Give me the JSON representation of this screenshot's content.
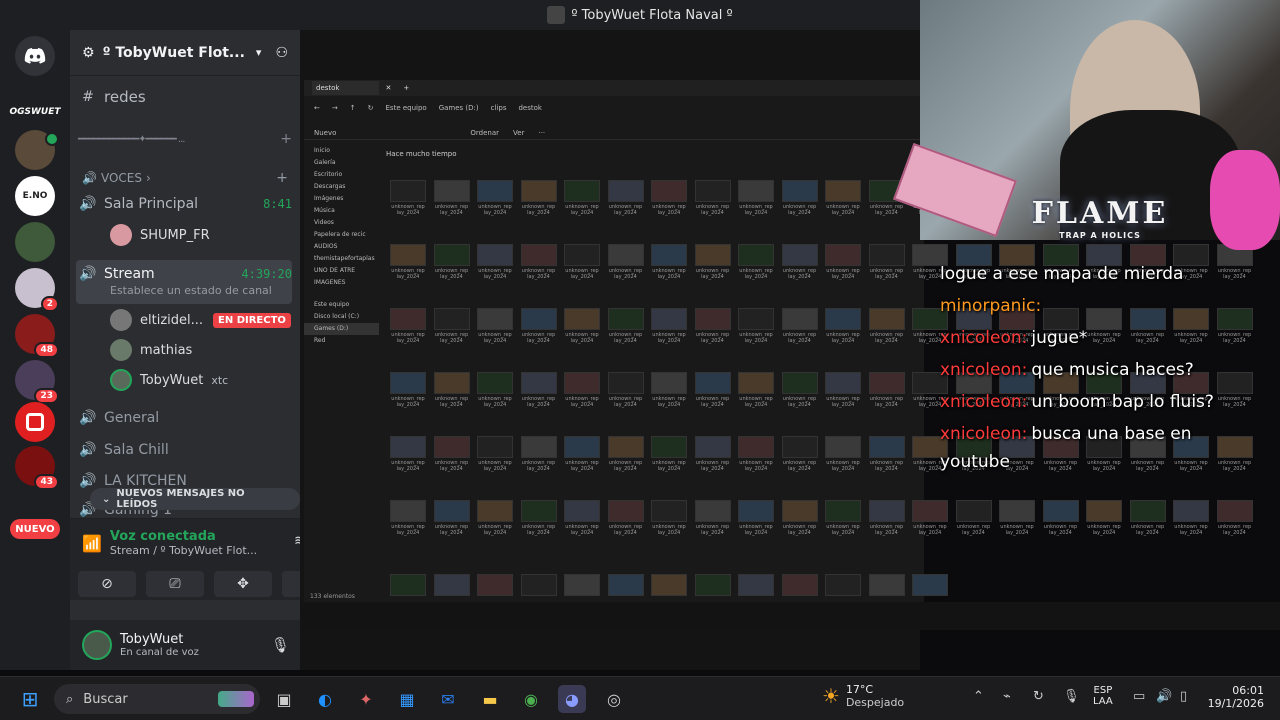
{
  "window": {
    "title": "º TobyWuet Flota Naval º"
  },
  "rail": {
    "servers": [
      {
        "name": "discord-home",
        "badge": ""
      },
      {
        "name": "server-ogswuet",
        "label": "OGSWUET",
        "badge": ""
      },
      {
        "name": "server-1",
        "badge": ""
      },
      {
        "name": "server-eno",
        "label": "E.NO",
        "badge": ""
      },
      {
        "name": "server-2",
        "badge": ""
      },
      {
        "name": "server-3",
        "badge": "2"
      },
      {
        "name": "server-4",
        "badge": "48"
      },
      {
        "name": "server-5",
        "badge": "23"
      },
      {
        "name": "server-6",
        "badge": ""
      },
      {
        "name": "server-7",
        "badge": "43"
      }
    ],
    "nuevo": "NUEVO"
  },
  "guild": {
    "name": "º TobyWuet Flot...",
    "channel_redes": "redes",
    "separator": "━━━━━━━━━━━━✦━━━━━━ ..."
  },
  "voice_category": "VOCES",
  "channels": {
    "sala_principal": {
      "name": "Sala Principal",
      "time": "8:41"
    },
    "shump": "SHUMP_FR",
    "stream": {
      "name": "Stream",
      "time": "4:39:20",
      "status": "Establece un estado de canal"
    },
    "users": [
      {
        "name": "eltizidel...",
        "live": "EN DIRECTO"
      },
      {
        "name": "mathias",
        "extra": ""
      },
      {
        "name": "TobyWuet",
        "extra": "xtc"
      }
    ],
    "general": "General",
    "sala_chill": "Sala Chill",
    "kitchen": "LA KITCHEN",
    "gaming": "Gaming 1",
    "new_messages": "NUEVOS MENSAJES NO LEÍDOS"
  },
  "voice_panel": {
    "status": "Voz conectada",
    "location": "Stream / º TobyWuet Flot..."
  },
  "user_panel": {
    "name": "TobyWuet",
    "status": "En canal de voz"
  },
  "explorer": {
    "tab": "destok",
    "path": [
      "Este equipo",
      "Games (D:)",
      "clips",
      "destok"
    ],
    "toolbar": [
      "Nuevo",
      "Ordenar",
      "Ver"
    ],
    "group": "Hace mucho tiempo",
    "nav": [
      "Inicio",
      "Galería",
      "Escritorio",
      "Descargas",
      "Imágenes",
      "Música",
      "Videos",
      "Papelera de recic",
      "AUDIOS",
      "themistapefortaplas",
      "UNO DE ATRE",
      "IMAGENES",
      "Este equipo",
      "Disco local (C:)",
      "Games (D:)",
      "Red"
    ],
    "count": "133 elementos",
    "file_label": "unknown_rep lay_2024"
  },
  "cam": {
    "title": "FLAME",
    "subtitle": "TRAP A HOLICS"
  },
  "chat": [
    {
      "user": "",
      "text": "logue a ese mapa de mierda",
      "color": "#ffffff"
    },
    {
      "user": "minorpanic:",
      "text": "",
      "color": "#ff9a1f"
    },
    {
      "user": "xnicoleon:",
      "text": "jugue*",
      "color": "#ff3b3b"
    },
    {
      "user": "xnicoleon:",
      "text": "que musica haces?",
      "color": "#ff3b3b"
    },
    {
      "user": "xnicoleon:",
      "text": "un boom bap lo fluis?",
      "color": "#ff3b3b"
    },
    {
      "user": "xnicoleon:",
      "text": "busca una base en",
      "color": "#ff3b3b"
    },
    {
      "user": "",
      "text": "youtube",
      "color": "#ffffff"
    }
  ],
  "taskbar": {
    "search": "Buscar",
    "weather_temp": "17°C",
    "weather_desc": "Despejado",
    "lang": "ESP",
    "lang2": "LAA",
    "time": "06:01",
    "date": "19/1/2026"
  }
}
